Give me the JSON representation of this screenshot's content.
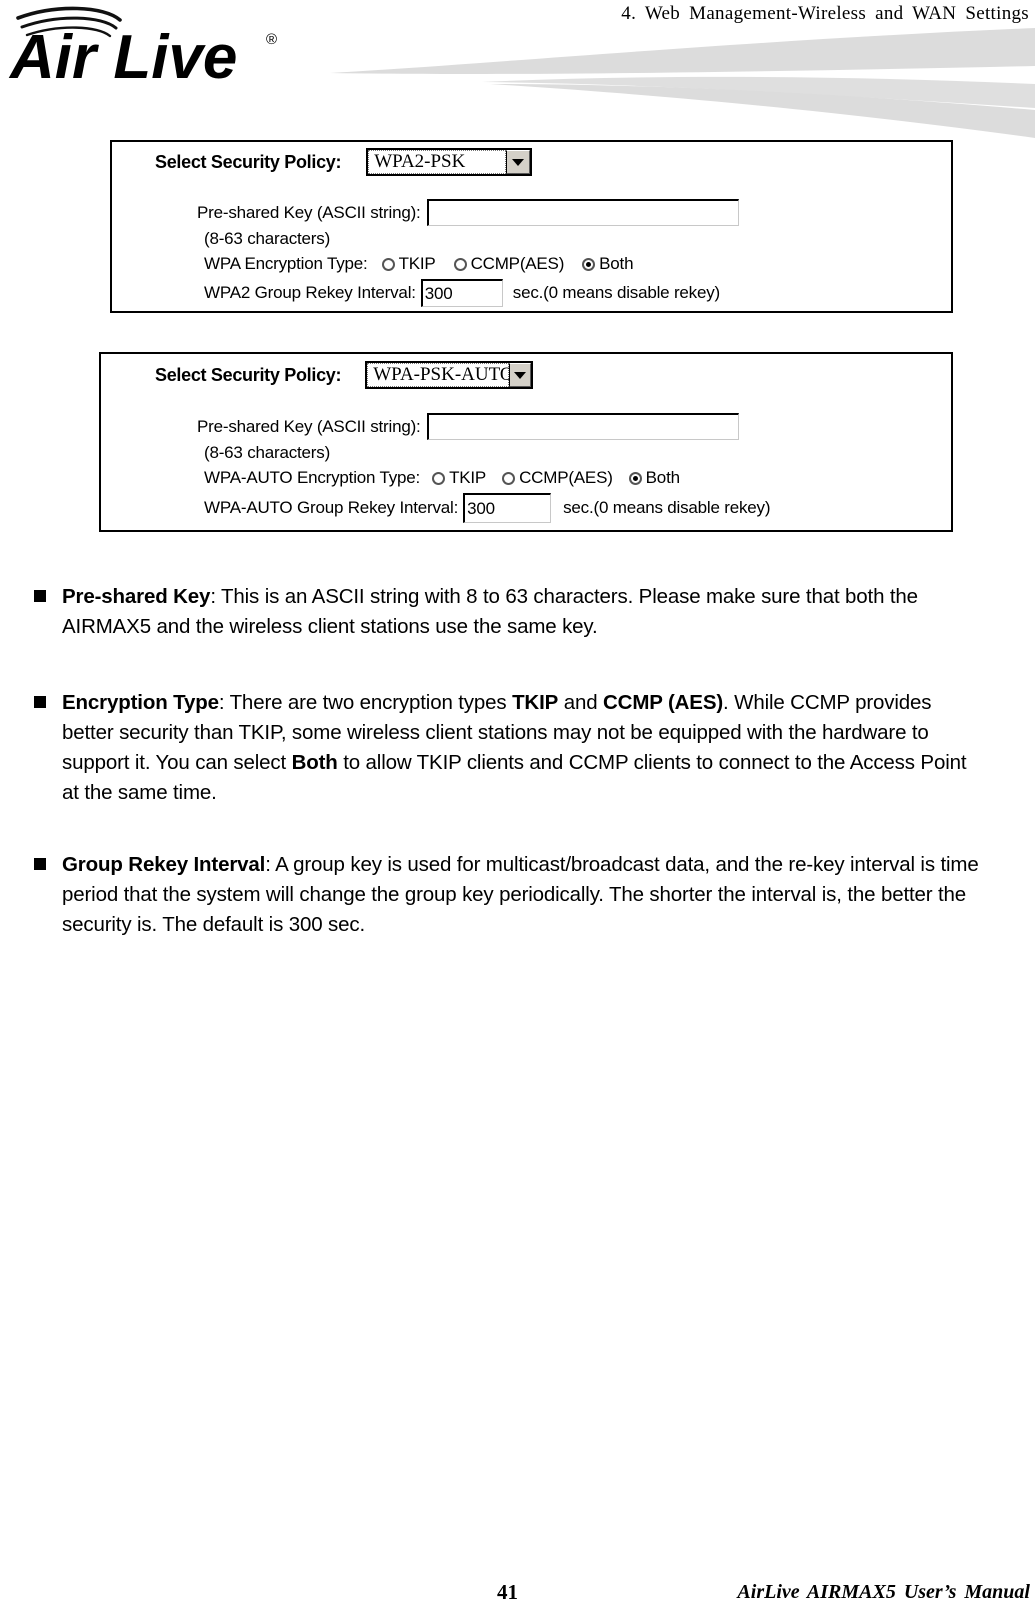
{
  "header": {
    "chapter_title": "4.  Web  Management-Wireless  and  WAN  Settings",
    "logo_text": "Air Live",
    "logo_registered": "®",
    "logo_icon": "wifi-arc-logo"
  },
  "panels": [
    {
      "id": "wpa2-psk",
      "policy_label": "Select Security Policy:",
      "policy_value": "WPA2-PSK",
      "psk_label": "Pre-shared Key (ASCII string):",
      "psk_value": "",
      "psk_hint": "(8-63 characters)",
      "encryption_label": "WPA Encryption Type:",
      "encryption_options": [
        {
          "label": "TKIP",
          "selected": false
        },
        {
          "label": "CCMP(AES)",
          "selected": false
        },
        {
          "label": "Both",
          "selected": true
        }
      ],
      "rekey_label": "WPA2 Group Rekey Interval:",
      "rekey_value": "300",
      "rekey_suffix": "sec.(0 means disable rekey)"
    },
    {
      "id": "wpa-psk-auto",
      "policy_label": "Select Security Policy:",
      "policy_value": "WPA-PSK-AUTO",
      "psk_label": "Pre-shared Key (ASCII string):",
      "psk_value": "",
      "psk_hint": "(8-63 characters)",
      "encryption_label": "WPA-AUTO Encryption Type:",
      "encryption_options": [
        {
          "label": "TKIP",
          "selected": false
        },
        {
          "label": "CCMP(AES)",
          "selected": false
        },
        {
          "label": "Both",
          "selected": true
        }
      ],
      "rekey_label": "WPA-AUTO Group Rekey Interval:",
      "rekey_value": "300",
      "rekey_suffix": "sec.(0 means disable rekey)"
    }
  ],
  "bullets": [
    {
      "term": "Pre-shared Key",
      "body": ": This is an ASCII string with 8 to 63 characters. Please make sure that both the AIRMAX5 and the wireless client stations use the same key."
    },
    {
      "term": "Encryption Type",
      "body_part1": ": There are two encryption types ",
      "emphasis1": "TKIP",
      "body_part2": " and ",
      "emphasis2": "CCMP (AES)",
      "body_part3": ". While CCMP provides better security than TKIP, some wireless client stations may not be equipped with the hardware to support it. You can select ",
      "emphasis3": "Both",
      "body_part4": " to allow TKIP clients and CCMP clients to connect to the Access Point at the same time."
    },
    {
      "term": "Group Rekey Interval",
      "body": ": A group key is used for multicast/broadcast data, and the re-key interval is time period that the system will change the group key periodically. The shorter the interval is, the better the security is. The default is 300 sec."
    }
  ],
  "footer": {
    "page_number": "41",
    "manual_title": "AirLive  AIRMAX5  User’s  Manual"
  },
  "colors": {
    "swoosh_gray": "#dcdcdc",
    "button_face": "#d4d0c8",
    "text_black": "#000000"
  }
}
